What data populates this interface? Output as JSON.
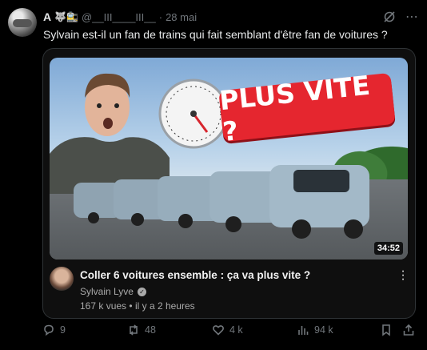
{
  "post": {
    "display_name": "A",
    "display_emojis": "🐺🚉",
    "handle": "@__III____III__",
    "separator": "·",
    "date": "28 mai",
    "text": "Sylvain est-il un fan de trains qui fait semblant d'être fan de voitures ?"
  },
  "video": {
    "thumbnail_text": "PLUS VITE ?",
    "duration": "34:52",
    "title": "Coller 6 voitures ensemble : ça va plus vite ?",
    "channel": "Sylvain Lyve",
    "views": "167 k vues",
    "age_sep": "•",
    "age": "il y a 2 heures"
  },
  "stats": {
    "replies": "9",
    "reposts": "48",
    "likes": "4 k",
    "views": "94 k"
  },
  "colors": {
    "background": "#000000",
    "text": "#e7e9ea",
    "muted": "#71767b",
    "badge_red": "#e5262f"
  },
  "icons": [
    "grok-icon",
    "more-icon",
    "reply-icon",
    "repost-icon",
    "like-icon",
    "views-icon",
    "bookmark-icon",
    "share-icon",
    "kebab-icon",
    "verified-icon"
  ]
}
